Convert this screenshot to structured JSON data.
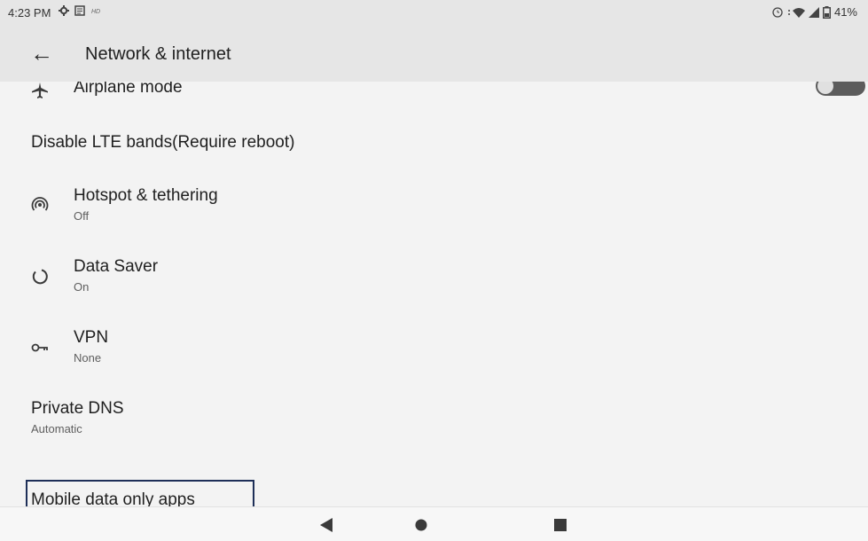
{
  "status_bar": {
    "time": "4:23 PM",
    "battery": "41%",
    "icons": [
      "gear-icon",
      "notes-icon",
      "hd-icon",
      "alarm-icon",
      "wifi-icon",
      "signal-icon",
      "battery-icon"
    ]
  },
  "app_bar": {
    "title": "Network & internet",
    "back_icon": "arrow-left-icon"
  },
  "settings": [
    {
      "id": "airplane",
      "title": "Airplane mode",
      "icon": "airplane-icon",
      "toggle": "off"
    },
    {
      "id": "lte",
      "title": "Disable LTE bands(Require reboot)"
    },
    {
      "id": "hotspot",
      "title": "Hotspot & tethering",
      "subtitle": "Off",
      "icon": "hotspot-icon"
    },
    {
      "id": "data_saver",
      "title": "Data Saver",
      "subtitle": "On",
      "icon": "data-saver-icon"
    },
    {
      "id": "vpn",
      "title": "VPN",
      "subtitle": "None",
      "icon": "vpn-key-icon"
    },
    {
      "id": "private_dns",
      "title": "Private DNS",
      "subtitle": "Automatic"
    },
    {
      "id": "mobile_data_apps",
      "title": "Mobile data only apps",
      "highlighted": true
    }
  ],
  "nav_bar": {
    "buttons": [
      "back-triangle-icon",
      "home-circle-icon",
      "recents-square-icon"
    ]
  },
  "colors": {
    "app_bar_bg": "#e6e6e6",
    "page_bg": "#f3f3f3",
    "toggle_off": "#5c5c5c",
    "highlight_border": "#1e2f58"
  }
}
